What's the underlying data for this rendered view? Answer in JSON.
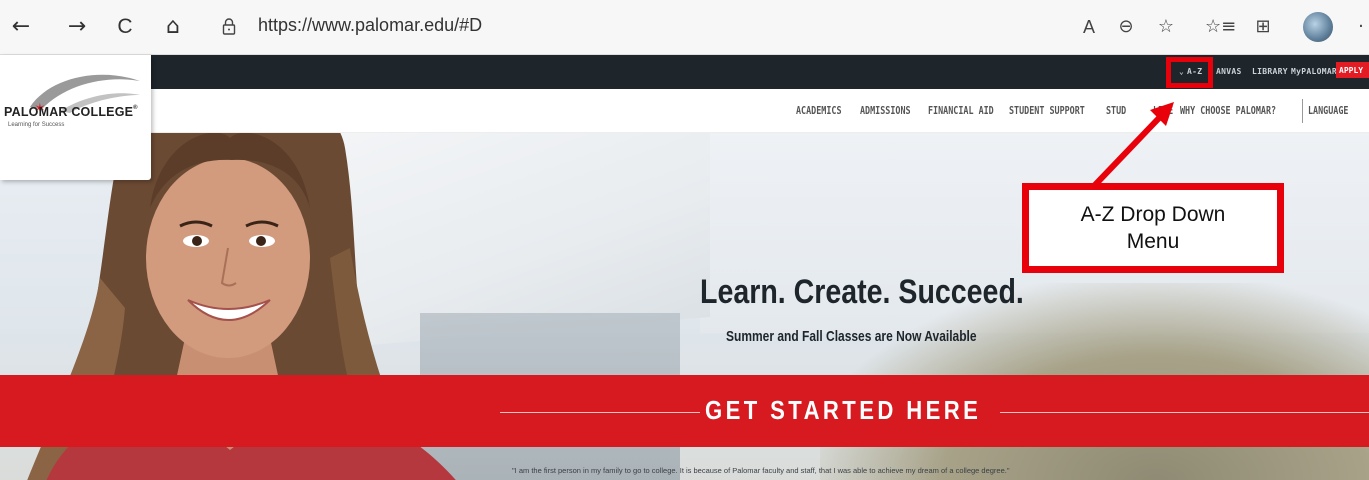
{
  "browser": {
    "url": "https://www.palomar.edu/#D",
    "back_glyph": "←",
    "forward_glyph": "→",
    "refresh_glyph": "C",
    "home_glyph": "⌂",
    "read_aloud_glyph": "A",
    "zoom_glyph": "⊖",
    "favorite_add_glyph": "☆",
    "favorites_glyph": "☆≡",
    "collections_glyph": "⊞",
    "more_glyph": "·"
  },
  "utility_nav": {
    "az": "A-Z",
    "canvas": "ANVAS",
    "library": "LIBRARY",
    "mypalomar": "MyPALOMAR",
    "apply": "APPLY"
  },
  "logo": {
    "name": "PALOMAR COLLEGE",
    "registered": "®",
    "tagline": "Learning for Success"
  },
  "main_nav": {
    "academics": "ACADEMICS",
    "admissions": "ADMISSIONS",
    "financial_aid": "FINANCIAL AID",
    "student_support": "STUDENT SUPPORT",
    "student_life_partial": "STUD",
    "life_partial": "LIFE",
    "why_choose": "WHY CHOOSE PALOMAR?",
    "language": "LANGUAGE"
  },
  "hero": {
    "headline": "Learn. Create. Succeed.",
    "subline": "Summer and Fall Classes are Now Available",
    "cta": "GET STARTED HERE",
    "quote": "\"I am the first person in my family to go to college. It is because of Palomar faculty and staff, that I was able to achieve my dream of a college degree.\""
  },
  "annotation": {
    "callout_text": "A-Z Drop Down Menu",
    "color": "#e8000b"
  },
  "colors": {
    "utility_bar": "#1e262c",
    "brand_red": "#d71920",
    "apply_red": "#e31b23"
  }
}
